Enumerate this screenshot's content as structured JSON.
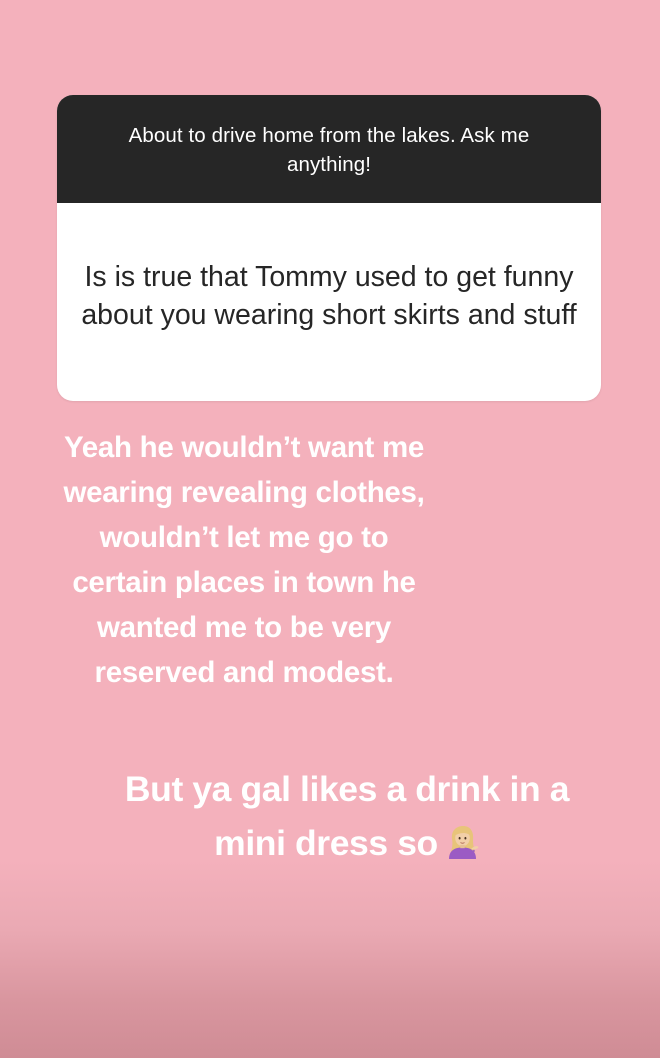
{
  "question_sticker": {
    "prompt": "About to drive home from the lakes. Ask me anything!",
    "question": "Is is true that Tommy used to get funny about you wearing short skirts and stuff"
  },
  "answer": {
    "lines": [
      "Yeah he wouldn’t want me",
      "wearing revealing clothes,",
      "wouldn’t let me go to",
      "certain places in town he",
      "wanted me to be very",
      "reserved and modest."
    ]
  },
  "followup": {
    "line1": "But ya gal likes a drink in a",
    "line2": "mini dress so",
    "emoji": "woman-tipping-hand-icon"
  },
  "colors": {
    "background": "#f4b1bc",
    "sticker_header": "#262626",
    "sticker_body": "#ffffff",
    "text_light": "#ffffff",
    "text_dark": "#262626"
  }
}
